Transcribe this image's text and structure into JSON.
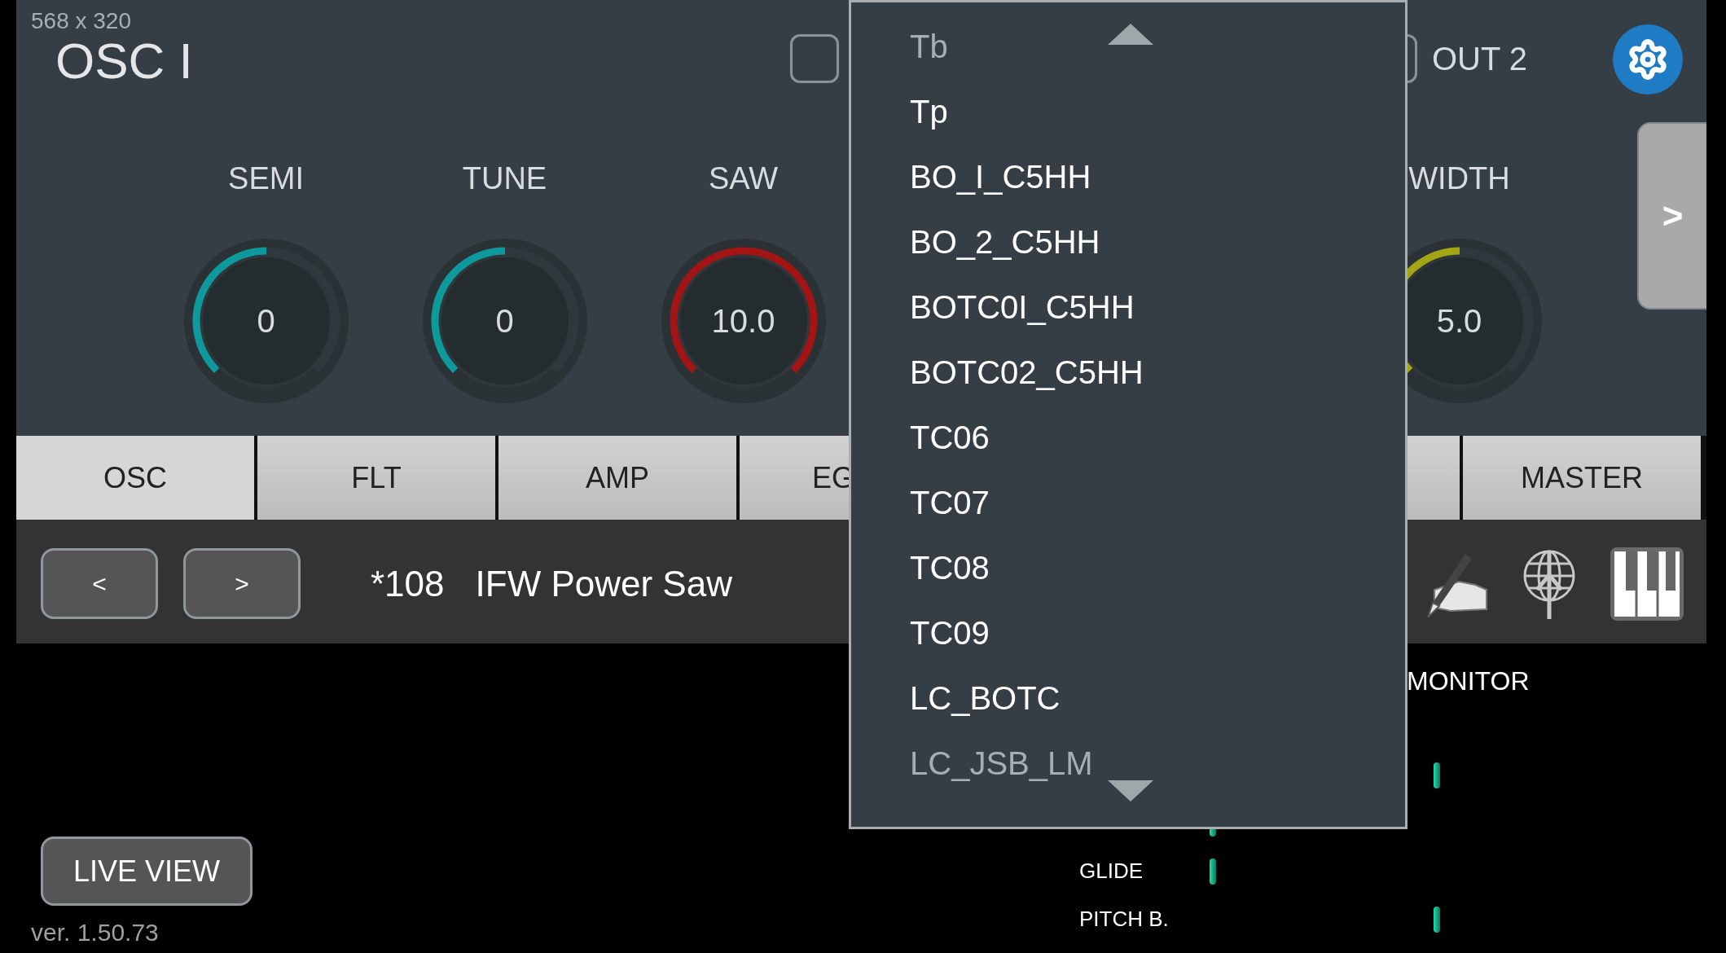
{
  "screen_size": "568 x 320",
  "title": "OSC I",
  "outputs": [
    {
      "checked": false
    },
    {
      "label": "OUT 2",
      "checked": false
    }
  ],
  "knobs": [
    {
      "label": "SEMI",
      "value": "0",
      "level": 0.5,
      "color": "#0e9a9c"
    },
    {
      "label": "TUNE",
      "value": "0",
      "level": 0.5,
      "color": "#0e9a9c"
    },
    {
      "label": "SAW",
      "value": "10.0",
      "level": 1.0,
      "color": "#a31414"
    },
    {
      "label": "WIDTH",
      "value": "5.0",
      "level": 0.5,
      "color": "#a5a514"
    }
  ],
  "side_tab": ">",
  "tabs": [
    {
      "label": "OSC",
      "selected": true
    },
    {
      "label": "FLT",
      "selected": false
    },
    {
      "label": "AMP",
      "selected": false
    },
    {
      "label": "EG",
      "selected": false
    },
    {
      "selected": false
    },
    {
      "label": "MASTER",
      "selected": false
    }
  ],
  "patch_bar": {
    "prev": "<",
    "next": ">",
    "number": "*108",
    "name": "IFW Power Saw"
  },
  "dropdown": {
    "items": [
      {
        "label": "Tb",
        "faded": true
      },
      {
        "label": "Tp",
        "faded": false
      },
      {
        "label": "BO_I_C5HH",
        "faded": false
      },
      {
        "label": "BO_2_C5HH",
        "faded": false
      },
      {
        "label": "BOTC0I_C5HH",
        "faded": false
      },
      {
        "label": "BOTC02_C5HH",
        "faded": false
      },
      {
        "label": "TC06",
        "faded": false
      },
      {
        "label": "TC07",
        "faded": false
      },
      {
        "label": "TC08",
        "faded": false
      },
      {
        "label": "TC09",
        "faded": false
      },
      {
        "label": "LC_BOTC",
        "faded": false
      },
      {
        "label": "LC_JSB_LM",
        "faded": true
      }
    ]
  },
  "monitor": {
    "title": "MONITOR",
    "rows": [
      {
        "level": 0.5
      },
      {
        "level": 0
      },
      {
        "label": "GLIDE",
        "level": 0
      },
      {
        "label": "PITCH B.",
        "level": 0.5
      }
    ]
  },
  "live_view": "LIVE VIEW",
  "version": "ver. 1.50.73"
}
